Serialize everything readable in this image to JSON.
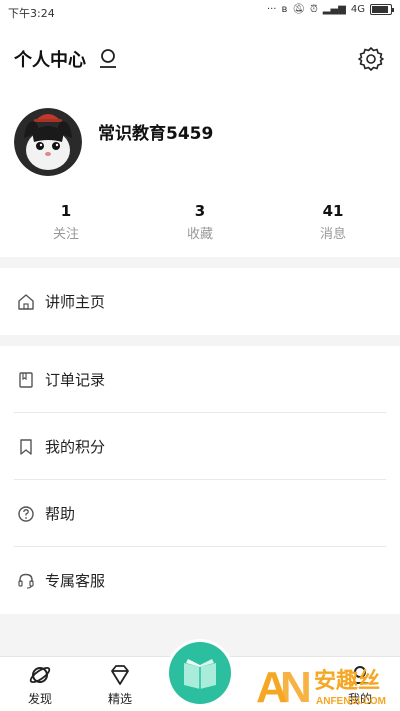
{
  "status": {
    "time": "下午3:24",
    "network": "4G"
  },
  "header": {
    "title": "个人中心"
  },
  "user": {
    "name": "常识教育5459"
  },
  "stats": [
    {
      "value": "1",
      "label": "关注"
    },
    {
      "value": "3",
      "label": "收藏"
    },
    {
      "value": "41",
      "label": "消息"
    }
  ],
  "menu": {
    "teacher": "讲师主页",
    "orders": "订单记录",
    "points": "我的积分",
    "help": "帮助",
    "service": "专属客服"
  },
  "tabs": {
    "discover": "发现",
    "featured": "精选",
    "mine": "我的"
  },
  "watermark": {
    "big": "安趣丝",
    "small": "ANFENSI.COM"
  },
  "colors": {
    "accent": "#2bbf9f",
    "watermark": "#f5a623"
  }
}
